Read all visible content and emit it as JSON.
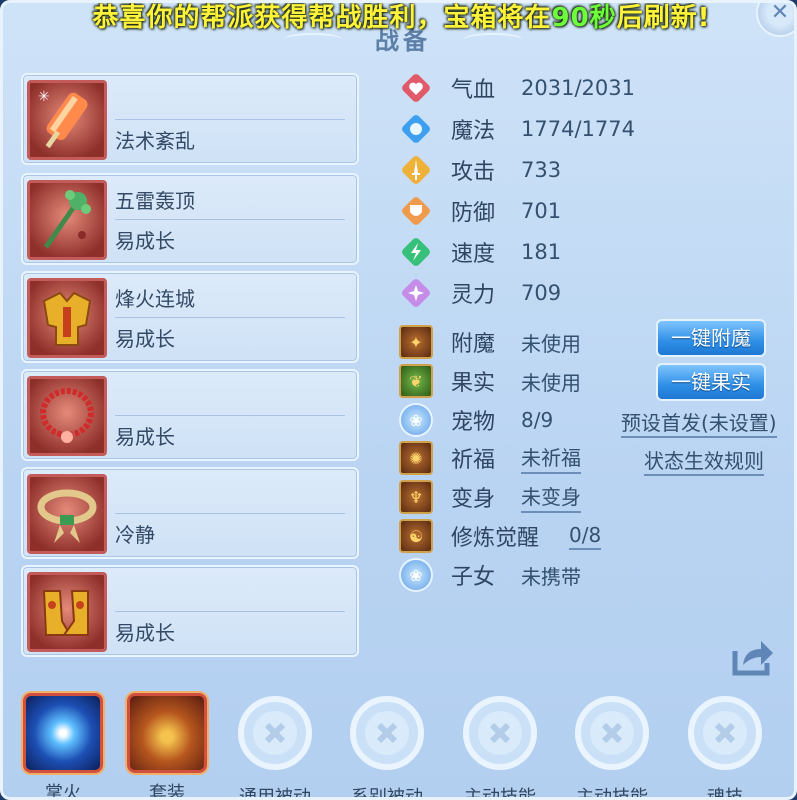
{
  "announcement": {
    "before": "恭喜你的帮派获得帮战胜利，宝箱将在",
    "highlight": "90秒",
    "after": "后刷新!"
  },
  "title": "战备",
  "equipment": [
    {
      "line1": "",
      "line2": "法术紊乱",
      "icon": "ice-lolly-icon"
    },
    {
      "line1": "五雷轰顶",
      "line2": "易成长",
      "icon": "jade-staff-icon"
    },
    {
      "line1": "烽火连城",
      "line2": "易成长",
      "icon": "golden-armor-icon"
    },
    {
      "line1": "",
      "line2": "易成长",
      "icon": "red-bead-necklace-icon"
    },
    {
      "line1": "",
      "line2": "冷静",
      "icon": "gold-belt-icon"
    },
    {
      "line1": "",
      "line2": "易成长",
      "icon": "golden-boots-icon"
    }
  ],
  "stats": [
    {
      "label": "气血",
      "value": "2031/2031",
      "icon": "heart-icon",
      "color": "#e05a6a"
    },
    {
      "label": "魔法",
      "value": "1774/1774",
      "icon": "mana-icon",
      "color": "#3e9ff0"
    },
    {
      "label": "攻击",
      "value": "733",
      "icon": "sword-icon",
      "color": "#f0b13a"
    },
    {
      "label": "防御",
      "value": "701",
      "icon": "shield-icon",
      "color": "#f09a4e"
    },
    {
      "label": "速度",
      "value": "181",
      "icon": "speed-icon",
      "color": "#36c07a"
    },
    {
      "label": "灵力",
      "value": "709",
      "icon": "spirit-icon",
      "color": "#c58de8"
    }
  ],
  "attrs": {
    "enchant": {
      "label": "附魔",
      "value": "未使用"
    },
    "fruit": {
      "label": "果实",
      "value": "未使用"
    },
    "pet": {
      "label": "宠物",
      "value": "8/9"
    },
    "blessing": {
      "label": "祈福",
      "value": "未祈福"
    },
    "transform": {
      "label": "变身",
      "value": "未变身"
    },
    "cultivation": {
      "label": "修炼觉醒",
      "value": "0/8"
    },
    "child": {
      "label": "子女",
      "value": "未携带"
    }
  },
  "buttons": {
    "one_key_enchant": "一键附魔",
    "one_key_fruit": "一键果实"
  },
  "links": {
    "preset_first": "预设首发(未设置)",
    "status_rules": "状态生效规则"
  },
  "skills": [
    {
      "label": "掌火",
      "active": true
    },
    {
      "label": "套装",
      "active": true
    },
    {
      "label": "通用被动",
      "active": false
    },
    {
      "label": "系别被动",
      "active": false
    },
    {
      "label": "主动技能",
      "active": false
    },
    {
      "label": "主动技能",
      "active": false
    },
    {
      "label": "魂技",
      "active": false
    }
  ]
}
